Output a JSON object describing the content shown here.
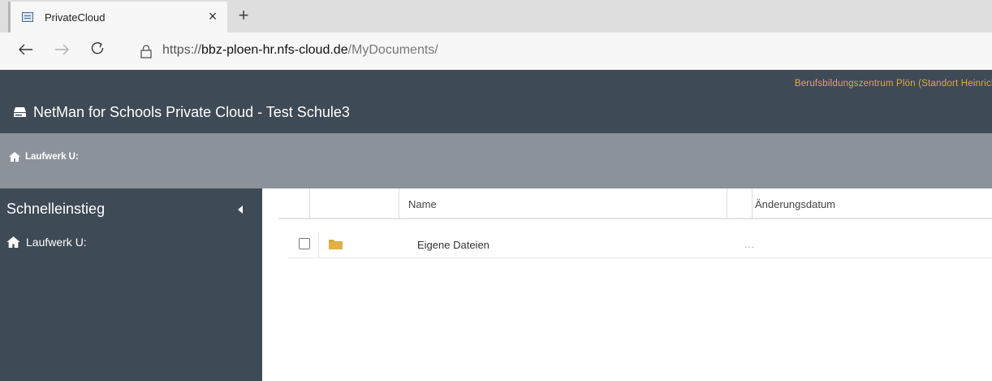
{
  "browser": {
    "tab_title": "PrivateCloud",
    "tab_close": "×",
    "new_tab": "+",
    "url": {
      "protocol": "https://",
      "host": "bbz-ploen-hr.nfs-cloud.de",
      "path": "/MyDocuments/"
    },
    "icons": {
      "favicon": "window-icon",
      "back": "arrow-left-icon",
      "forward": "arrow-right-icon",
      "reload": "reload-icon",
      "lock": "lock-icon"
    }
  },
  "header": {
    "organization": "Berufsbildungszentrum Plön (Standort Heinrich Riepe",
    "title": "NetMan for Schools Private Cloud - Test Schule3",
    "logo_icon": "cloud-drive-icon"
  },
  "breadcrumb": {
    "label": "Laufwerk U:",
    "icon": "home-icon"
  },
  "sidebar": {
    "heading": "Schnelleinstieg",
    "items": [
      {
        "label": "Laufwerk U:",
        "icon": "home-icon"
      }
    ]
  },
  "table": {
    "columns": [
      "Name",
      "Änderungsdatum"
    ],
    "rows": [
      {
        "name": "Eigene Dateien",
        "type_icon": "folder-icon",
        "date": "",
        "more": "..."
      }
    ]
  },
  "colors": {
    "header_bg": "#3e4a56",
    "crumb_bg": "#8b929a",
    "org_text": "#e3a949",
    "folder": "#d9a83b"
  }
}
